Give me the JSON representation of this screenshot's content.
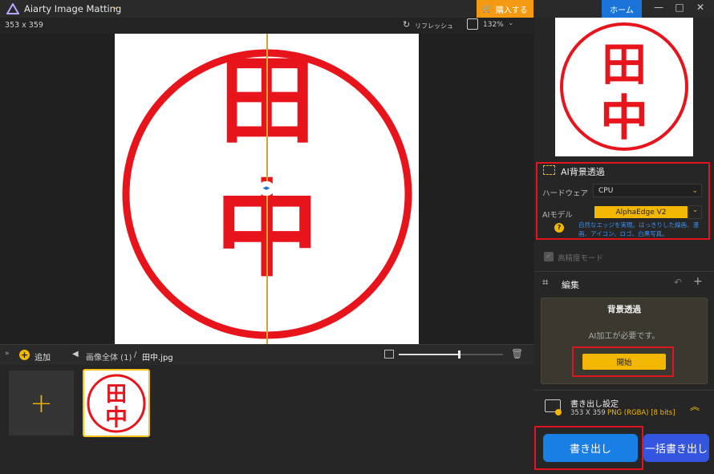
{
  "app": {
    "title": "Aiarty Image Matting",
    "buy_label": "購入する",
    "home_label": "ホーム"
  },
  "toolbar": {
    "dimensions": "353 x 359",
    "refresh_label": "リフレッシュ",
    "zoom": "132%"
  },
  "filmstrip": {
    "add_label": "追加",
    "breadcrumb_all": "画像全体 (1)",
    "breadcrumb_sep": "/",
    "file_name": "田中.jpg",
    "zoom_fraction": 0.58
  },
  "stamp": {
    "chars": [
      "田",
      "中"
    ],
    "color": "#e8141c"
  },
  "panel": {
    "ai_section_title": "AI背景透過",
    "hardware_label": "ハードウェア",
    "hardware_value": "CPU",
    "model_label": "AIモデル",
    "model_value": "AlphaEdge V2",
    "model_desc": "自然なエッジを実現。はっきりした線画、漫画、アイコン、ロゴ、白黒写真。",
    "hq_mode_label": "高精度モード",
    "edit_label": "編集",
    "bg_card_title": "背景透過",
    "bg_card_message": "AI加工が必要です。",
    "start_label": "開始",
    "export_settings_label": "書き出し設定",
    "export_size": "353 X 359",
    "export_format": "PNG (RGBA) [8 bits]",
    "export_label": "書き出し",
    "batch_export_label": "一括書き出し"
  },
  "colors": {
    "accent": "#1a7fe4",
    "warn": "#f39a12",
    "highlight": "#e0141e",
    "gold": "#f2b700"
  }
}
